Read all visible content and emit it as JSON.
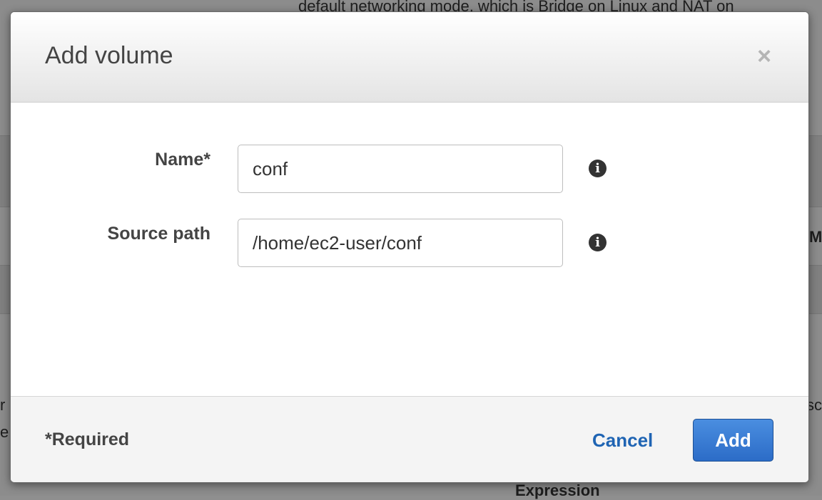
{
  "background": {
    "top_text": "default networking mode, which is Bridge on Linux and NAT on",
    "bottom_text": "Expression",
    "left_frag_1": "r",
    "left_frag_2": "e",
    "right_frag_1": "sc",
    "right_frag_2": "M"
  },
  "dialog": {
    "title": "Add volume",
    "close_symbol": "×",
    "fields": {
      "name": {
        "label": "Name*",
        "value": "conf",
        "info_icon": "i"
      },
      "source_path": {
        "label": "Source path",
        "value": "/home/ec2-user/conf",
        "info_icon": "i"
      }
    },
    "footer": {
      "required_note": "*Required",
      "cancel_label": "Cancel",
      "add_label": "Add"
    }
  },
  "colors": {
    "primary_button": "#2c6cc7",
    "link": "#1f64b3",
    "overlay": "#8c8c8c"
  },
  "icons": {
    "close": "close-icon",
    "info": "info-icon"
  }
}
